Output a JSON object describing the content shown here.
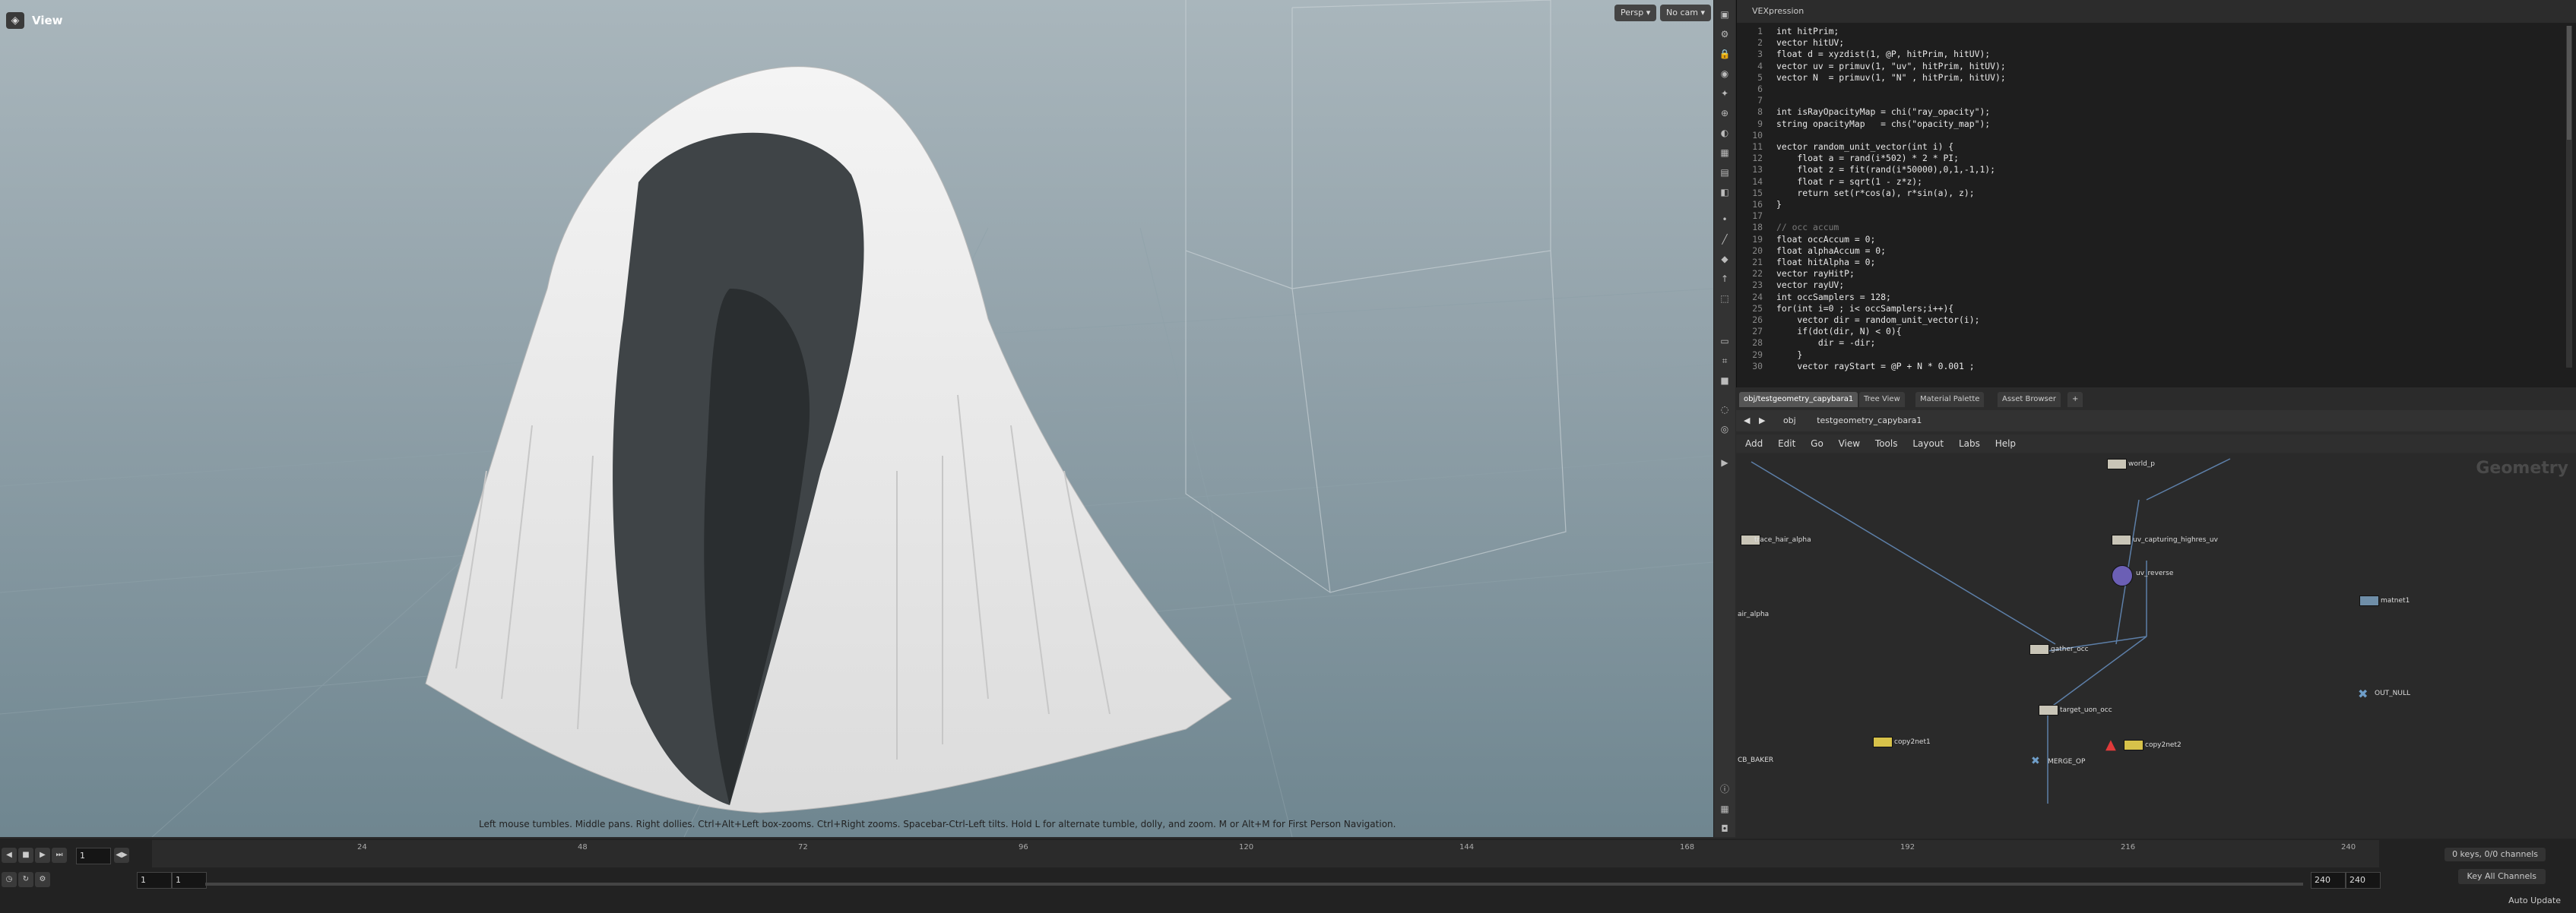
{
  "viewport": {
    "title": "View",
    "camera_persp": "Persp ▾",
    "camera_nocam": "No cam ▾",
    "hint": "Left mouse tumbles. Middle pans. Right dollies. Ctrl+Alt+Left box-zooms. Ctrl+Right zooms. Spacebar-Ctrl-Left tilts. Hold L for alternate tumble, dolly, and zoom. M or Alt+M for First Person Navigation."
  },
  "vex": {
    "title": "VEXpression",
    "lines": [
      {
        "n": "1",
        "code": "int hitPrim;"
      },
      {
        "n": "2",
        "code": "vector hitUV;"
      },
      {
        "n": "3",
        "code": "float d = xyzdist(1, @P, hitPrim, hitUV);"
      },
      {
        "n": "4",
        "code": "vector uv = primuv(1, \"uv\", hitPrim, hitUV);"
      },
      {
        "n": "5",
        "code": "vector N  = primuv(1, \"N\" , hitPrim, hitUV);"
      },
      {
        "n": "6",
        "code": ""
      },
      {
        "n": "7",
        "code": ""
      },
      {
        "n": "8",
        "code": "int isRayOpacityMap = chi(\"ray_opacity\");"
      },
      {
        "n": "9",
        "code": "string opacityMap   = chs(\"opacity_map\");"
      },
      {
        "n": "10",
        "code": ""
      },
      {
        "n": "11",
        "code": "vector random_unit_vector(int i) {"
      },
      {
        "n": "12",
        "code": "    float a = rand(i*502) * 2 * PI;"
      },
      {
        "n": "13",
        "code": "    float z = fit(rand(i*50000),0,1,-1,1);"
      },
      {
        "n": "14",
        "code": "    float r = sqrt(1 - z*z);"
      },
      {
        "n": "15",
        "code": "    return set(r*cos(a), r*sin(a), z);"
      },
      {
        "n": "16",
        "code": "}"
      },
      {
        "n": "17",
        "code": ""
      },
      {
        "n": "18",
        "code": "// occ accum"
      },
      {
        "n": "19",
        "code": "float occAccum = 0;"
      },
      {
        "n": "20",
        "code": "float alphaAccum = 0;"
      },
      {
        "n": "21",
        "code": "float hitAlpha = 0;"
      },
      {
        "n": "22",
        "code": "vector rayHitP;"
      },
      {
        "n": "23",
        "code": "vector rayUV;"
      },
      {
        "n": "24",
        "code": "int occSamplers = 128;"
      },
      {
        "n": "25",
        "code": "for(int i=0 ; i< occSamplers;i++){"
      },
      {
        "n": "26",
        "code": "    vector dir = random_unit_vector(i);"
      },
      {
        "n": "27",
        "code": "    if(dot(dir, N) < 0){"
      },
      {
        "n": "28",
        "code": "        dir = -dir;"
      },
      {
        "n": "29",
        "code": "    }"
      },
      {
        "n": "30",
        "code": "    vector rayStart = @P + N * 0.001 ;"
      }
    ]
  },
  "network": {
    "tabs": [
      "obj/testgeometry_capybara1",
      "Tree View",
      "Material Palette",
      "Asset Browser",
      "+"
    ],
    "path_root": "obj",
    "path_node": "testgeometry_capybara1",
    "menus": [
      "Add",
      "Edit",
      "Go",
      "View",
      "Tools",
      "Layout",
      "Labs",
      "Help"
    ],
    "context_label": "Geometry",
    "nodes": [
      {
        "label": "trace_hair_alpha"
      },
      {
        "label": "world_p"
      },
      {
        "label": "uv_capturing_highres_uv"
      },
      {
        "label": "uv_reverse"
      },
      {
        "label": "gather_occ"
      },
      {
        "label": "target_uon_occ"
      },
      {
        "label": "MERGE_OP"
      },
      {
        "label": "copy2net1"
      },
      {
        "label": "copy2net2"
      },
      {
        "label": "OUT_NULL"
      },
      {
        "label": "matnet1"
      },
      {
        "label": "air_alpha"
      },
      {
        "label": "CB_BAKER"
      }
    ]
  },
  "timeline": {
    "ticks": [
      "24",
      "48",
      "72",
      "96",
      "120",
      "144",
      "168",
      "192",
      "216",
      "240"
    ],
    "current_frame": "1",
    "start_frame": "1",
    "start_frame2": "1",
    "end_frame": "240",
    "end_frame2": "240",
    "keys": "0 keys, 0/0 channels",
    "key_all": "Key All Channels",
    "auto_update": "Auto Update"
  }
}
